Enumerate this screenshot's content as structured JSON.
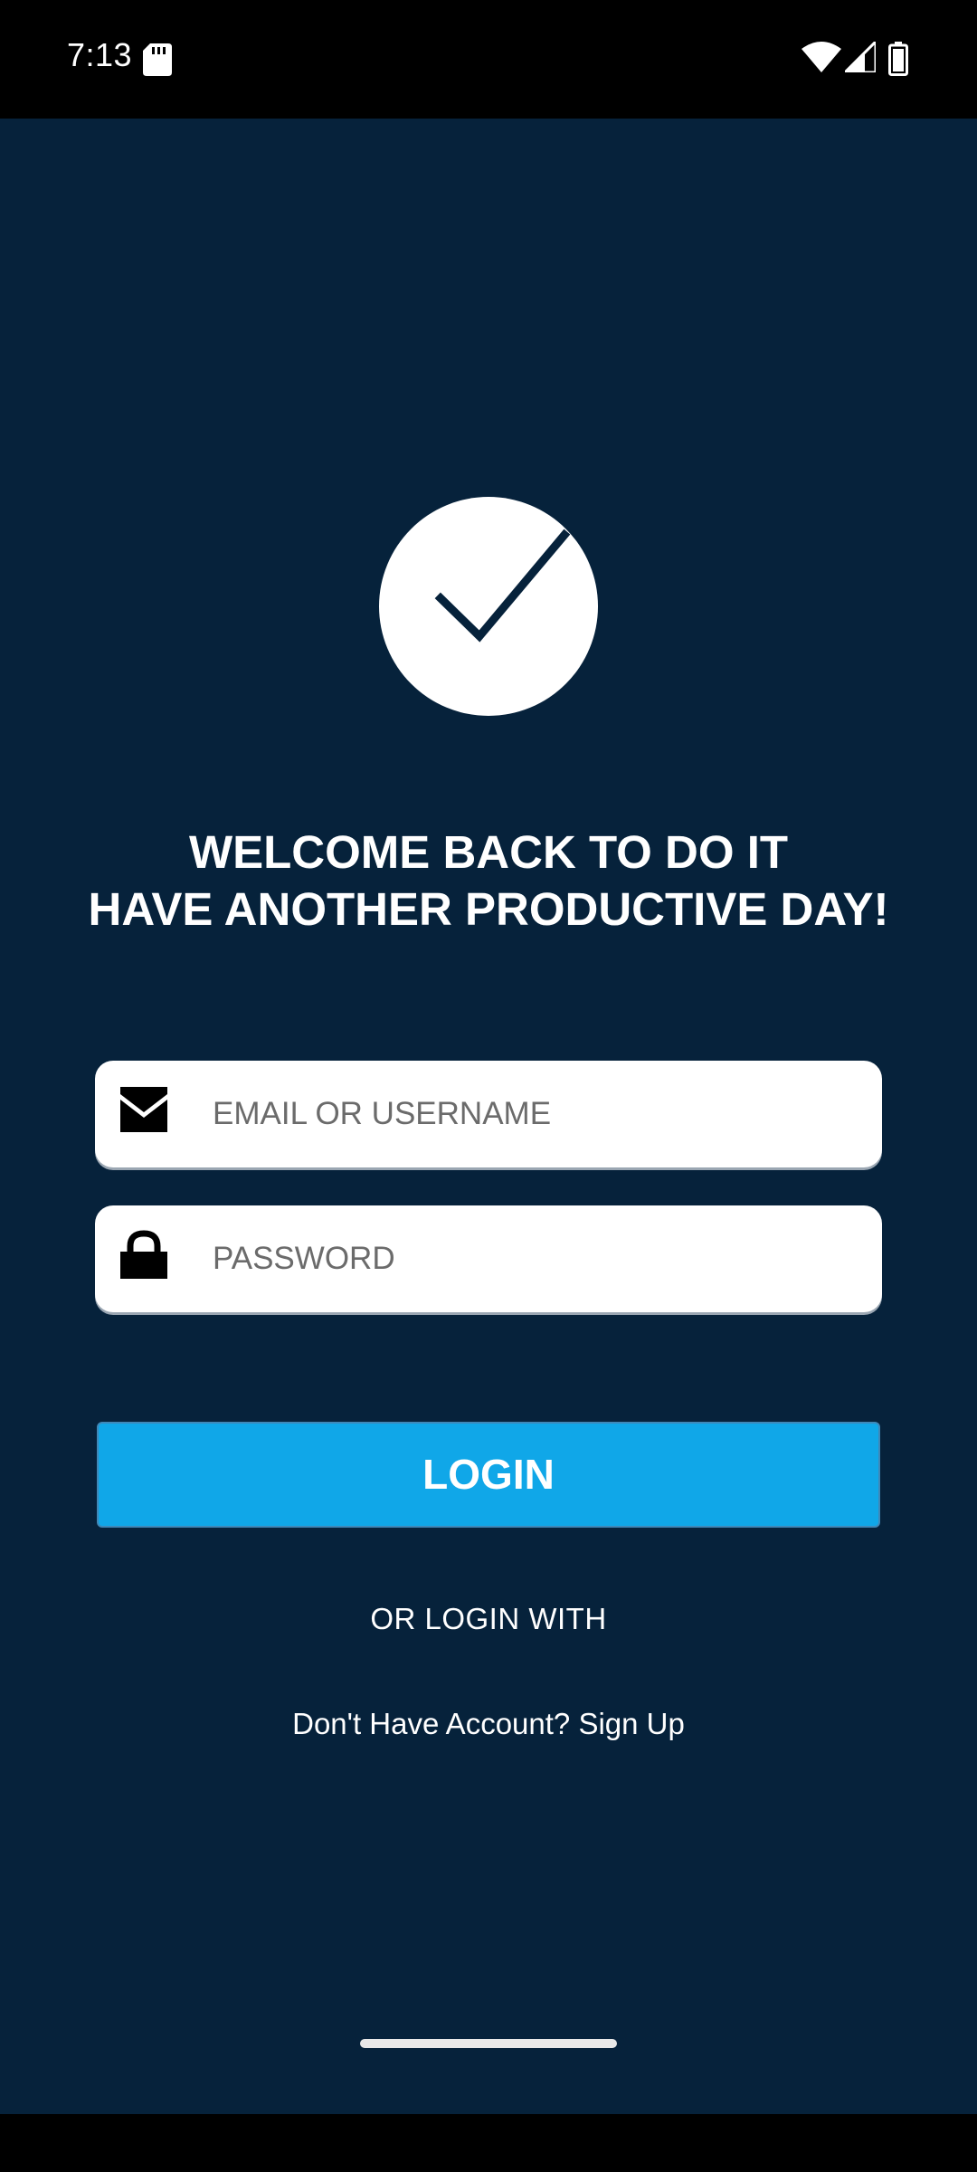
{
  "status_bar": {
    "time": "7:13",
    "icons": [
      "sd-card-icon",
      "wifi-icon",
      "signal-icon",
      "battery-icon"
    ]
  },
  "colors": {
    "background": "#06223b",
    "accent": "#10a7e8",
    "text": "#ffffff"
  },
  "logo": {
    "icon": "checkmark-circle-icon"
  },
  "welcome": {
    "line1": "WELCOME BACK TO DO IT",
    "line2": "HAVE ANOTHER PRODUCTIVE DAY!"
  },
  "form": {
    "email": {
      "icon": "envelope-icon",
      "placeholder": "EMAIL OR USERNAME",
      "value": ""
    },
    "password": {
      "icon": "lock-icon",
      "placeholder": "PASSWORD",
      "value": ""
    },
    "login_label": "LOGIN"
  },
  "alt_login": {
    "label": "OR LOGIN WITH"
  },
  "signup": {
    "label": "Don't Have Account? Sign Up"
  }
}
